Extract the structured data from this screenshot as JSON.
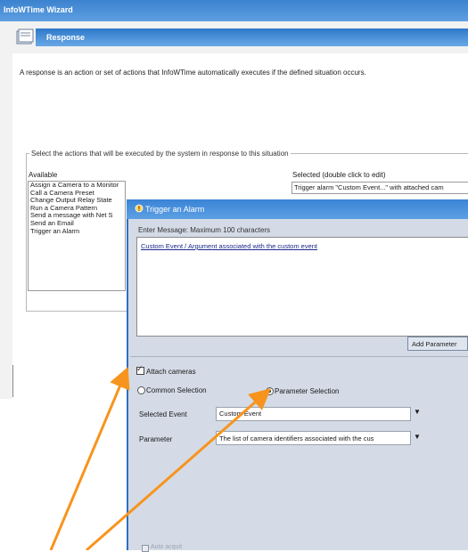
{
  "wizard": {
    "title": "InfoWTime Wizard",
    "header": "Response",
    "description": "A response is an action or set of actions that InfoWTime automatically executes if the defined situation occurs.",
    "group_caption": "Select the actions that will be executed by the system in response to this situation",
    "available_label": "Available",
    "available_items": [
      "Assign a Camera to a Monitor",
      "Call a Camera Preset",
      "Change Output Relay State",
      "Run a Camera Pattern",
      "Send a message with Net S",
      "Send an Email",
      "Trigger an Alarm"
    ],
    "selected_label": "Selected (double click to edit)",
    "selected_items": [
      "Trigger alarm \"Custom Event...\" with attached cam"
    ]
  },
  "dialog": {
    "title": "Trigger an Alarm",
    "message_label": "Enter Message: Maximum 100 characters",
    "message_text": "Custom Event / Argument associated with the custom event",
    "add_parameter_label": "Add Parameter",
    "attach_cameras_label": "Attach cameras",
    "attach_cameras_checked": true,
    "radio_common_label": "Common Selection",
    "radio_parameter_label": "Parameter Selection",
    "selected_radio": "parameter",
    "selected_event_label": "Selected Event",
    "selected_event_value": "Custom Event",
    "parameter_label": "Parameter",
    "parameter_value": "The list of camera identifiers associated with the cus",
    "bottom_checkbox_label": "Auto acquit"
  },
  "colors": {
    "title_bar": "#3b82cf",
    "dialog_background": "#d4dbe6",
    "annotation_arrow": "#f7941d"
  },
  "icons": {
    "wizard_header": "wizard-page-icon",
    "dialog_title": "alarm-icon",
    "dropdown": "chevron-down-icon"
  }
}
